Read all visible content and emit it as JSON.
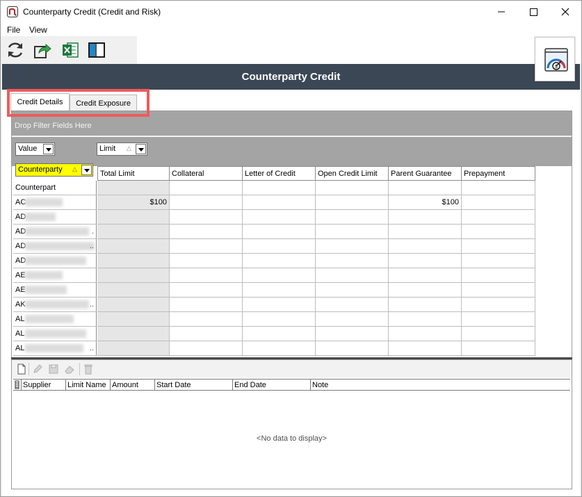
{
  "window": {
    "title": "Counterparty Credit (Credit and Risk)"
  },
  "menu": {
    "file": "File",
    "view": "View"
  },
  "toolbar": {
    "icons": [
      "refresh-icon",
      "export-icon",
      "excel-icon",
      "layout-icon"
    ]
  },
  "header": {
    "title": "Counterparty Credit"
  },
  "tabs": [
    {
      "label": "Credit Details",
      "selected": true
    },
    {
      "label": "Credit Exposure",
      "selected": false
    }
  ],
  "pivot": {
    "filter_hint": "Drop Filter Fields Here",
    "data_field": "Value",
    "column_field": "Limit",
    "row_field": "Counterparty",
    "columns": [
      "Total Limit",
      "Collateral",
      "Letter of Credit",
      "Open Credit Limit",
      "Parent Guarantee",
      "Prepayment"
    ],
    "row_header_label": "Counterpart",
    "rows": [
      {
        "prefix": "AC",
        "ellipsis": "",
        "values": [
          "$100",
          "",
          "",
          "",
          "$100",
          ""
        ]
      },
      {
        "prefix": "AD",
        "ellipsis": "",
        "values": [
          "",
          "",
          "",
          "",
          "",
          ""
        ]
      },
      {
        "prefix": "AD",
        "ellipsis": ".",
        "values": [
          "",
          "",
          "",
          "",
          "",
          ""
        ]
      },
      {
        "prefix": "AD",
        "ellipsis": "..",
        "values": [
          "",
          "",
          "",
          "",
          "",
          ""
        ]
      },
      {
        "prefix": "AD",
        "ellipsis": "",
        "values": [
          "",
          "",
          "",
          "",
          "",
          ""
        ]
      },
      {
        "prefix": "AE",
        "ellipsis": "",
        "values": [
          "",
          "",
          "",
          "",
          "",
          ""
        ]
      },
      {
        "prefix": "AE",
        "ellipsis": "",
        "values": [
          "",
          "",
          "",
          "",
          "",
          ""
        ]
      },
      {
        "prefix": "AK",
        "ellipsis": "..",
        "values": [
          "",
          "",
          "",
          "",
          "",
          ""
        ]
      },
      {
        "prefix": "AL",
        "ellipsis": "",
        "values": [
          "",
          "",
          "",
          "",
          "",
          ""
        ]
      },
      {
        "prefix": "AL",
        "ellipsis": "",
        "values": [
          "",
          "",
          "",
          "",
          "",
          ""
        ]
      },
      {
        "prefix": "AL",
        "ellipsis": "..",
        "values": [
          "",
          "",
          "",
          "",
          "",
          ""
        ]
      }
    ]
  },
  "limits_list": {
    "columns": [
      "Supplier",
      "Limit Name",
      "Amount",
      "Start Date",
      "End Date",
      "Note"
    ],
    "empty_text": "<No data to display>"
  }
}
